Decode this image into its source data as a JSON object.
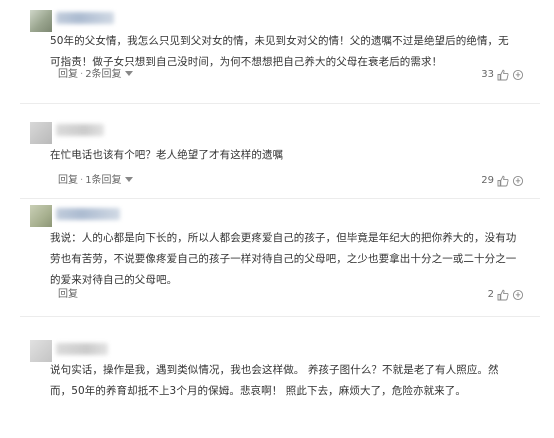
{
  "comments": [
    {
      "text_lines": [
        "50年的父女情，我怎么只见到父对女的情，未见到女对父的情！父的遗嘱不过是绝望后的绝情，无",
        "可指责！做子女只想到自己没时间，为何不想想把自己养大的父母在衰老后的需求！"
      ],
      "reply_label": "回复",
      "replies_label": "2条回复",
      "likes": "33"
    },
    {
      "text_lines": [
        "在忙电话也该有个吧？老人绝望了才有这样的遗嘱"
      ],
      "reply_label": "回复",
      "replies_label": "1条回复",
      "likes": "29"
    },
    {
      "text_lines": [
        "我说：人的心都是向下长的，所以人都会更疼爱自己的孩子，但毕竟是年纪大的把你养大的，没有功",
        "劳也有苦劳，不说要像疼爱自己的孩子一样对待自己的父母吧，之少也要拿出十分之一或二十分之一",
        "的爱来对待自己的父母吧。"
      ],
      "reply_label": "回复",
      "likes": "2"
    },
    {
      "text_lines": [
        "说句实话，操作是我，遇到类似情况，我也会这样做。 养孩子图什么？不就是老了有人照应。然",
        "而，50年的养育却抵不上3个月的保姆。悲哀啊！ 照此下去，麻烦大了，危险亦就来了。"
      ]
    }
  ]
}
